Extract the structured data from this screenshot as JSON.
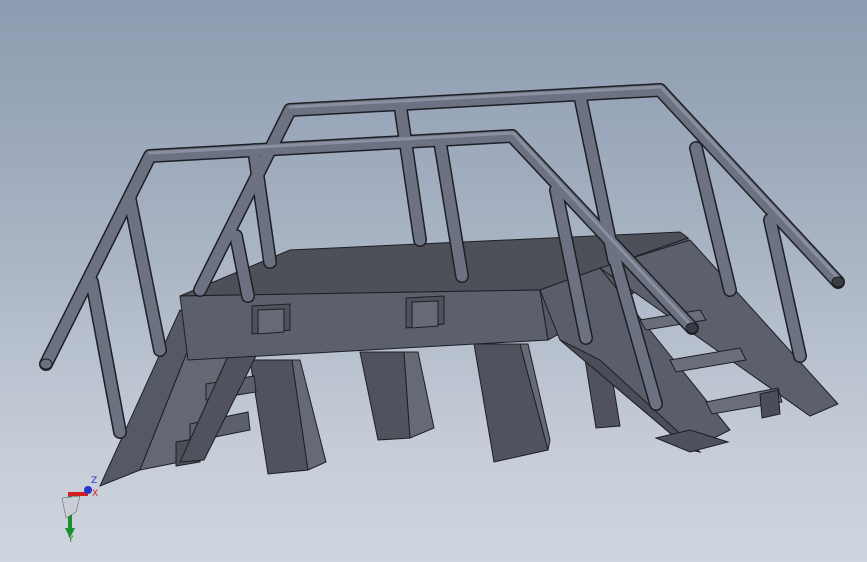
{
  "viewport": {
    "background_top": "#8d9bb0",
    "background_bottom": "#cfd5de"
  },
  "model": {
    "body_color": "#5c606c",
    "face_light": "#6a6e7a",
    "face_dark": "#4b4e58",
    "edge_color": "#1d1f24",
    "rail_color": "#6c7282"
  },
  "triad": {
    "x_label": "X",
    "y_label": "Y",
    "z_label": "Z",
    "x_color": "#d21f1f",
    "y_color": "#1a8f2b",
    "z_color": "#2336c8"
  }
}
